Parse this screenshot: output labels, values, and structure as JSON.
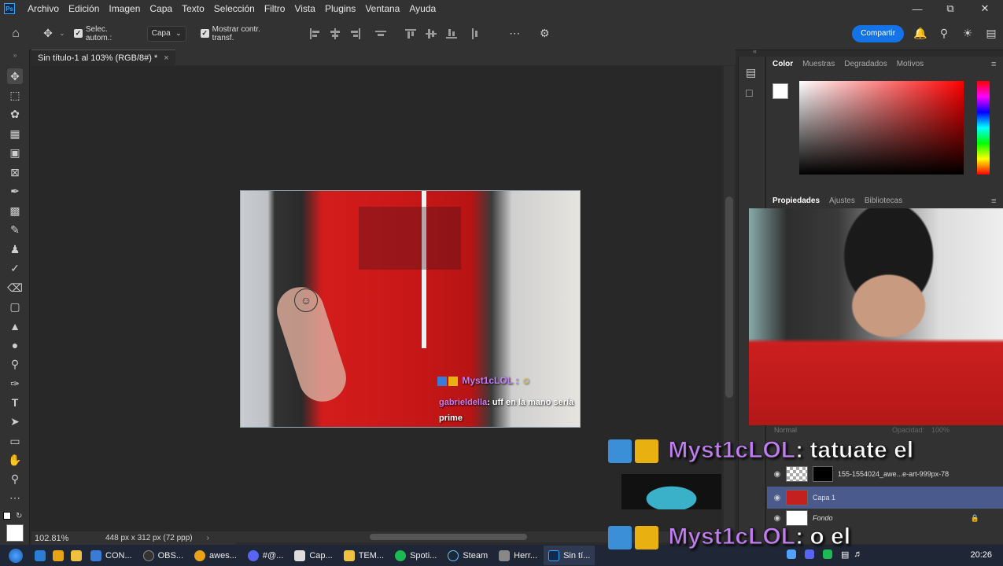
{
  "menu": {
    "app_icon": "Ps",
    "items": [
      "Archivo",
      "Edición",
      "Imagen",
      "Capa",
      "Texto",
      "Selección",
      "Filtro",
      "Vista",
      "Plugins",
      "Ventana",
      "Ayuda"
    ]
  },
  "options": {
    "auto_select_label": "Selec. autom.:",
    "auto_select_target": "Capa",
    "show_transform_label": "Mostrar contr. transf.",
    "share_label": "Compartir"
  },
  "document": {
    "tab_title": "Sin título-1 al 103% (RGB/8#) *",
    "close_glyph": "×"
  },
  "status": {
    "zoom": "102.81%",
    "dimensions": "448 px x 312 px (72 ppp)"
  },
  "canvas_overlay": {
    "badge_user": "Myst1cLOL :",
    "chat_user": "gabrieldella",
    "chat_message": ": uff en la mano sería prime"
  },
  "color_panel": {
    "tabs": [
      "Color",
      "Muestras",
      "Degradados",
      "Motivos"
    ],
    "active_tab": "Color"
  },
  "properties_panel": {
    "tabs": [
      "Propiedades",
      "Ajustes",
      "Bibliotecas"
    ],
    "active_tab": "Propiedades"
  },
  "layers": {
    "blend_mode": "Normal",
    "opacity_label": "Opacidad:",
    "opacity_value": "100%",
    "items": [
      {
        "name": "155-1554024_awe...e-art-999px-78",
        "selected": false
      },
      {
        "name": "Capa 1",
        "selected": true
      },
      {
        "name": "Fondo",
        "selected": false
      }
    ]
  },
  "stream_chat": [
    {
      "user": "Myst1cLOL",
      "message": ": tatuate el"
    },
    {
      "user": "Myst1cLOL",
      "message": ": o el"
    }
  ],
  "taskbar": {
    "apps": [
      "CON...",
      "OBS...",
      "awes...",
      "#@...",
      "Cap...",
      "TEM...",
      "Spoti...",
      "Steam",
      "Herr...",
      "Sin tí..."
    ],
    "clock": "20:26"
  },
  "colors": {
    "accent": "#1473e6",
    "chat_purple": "#c37df4",
    "layer_selected": "#4b5a8c"
  }
}
